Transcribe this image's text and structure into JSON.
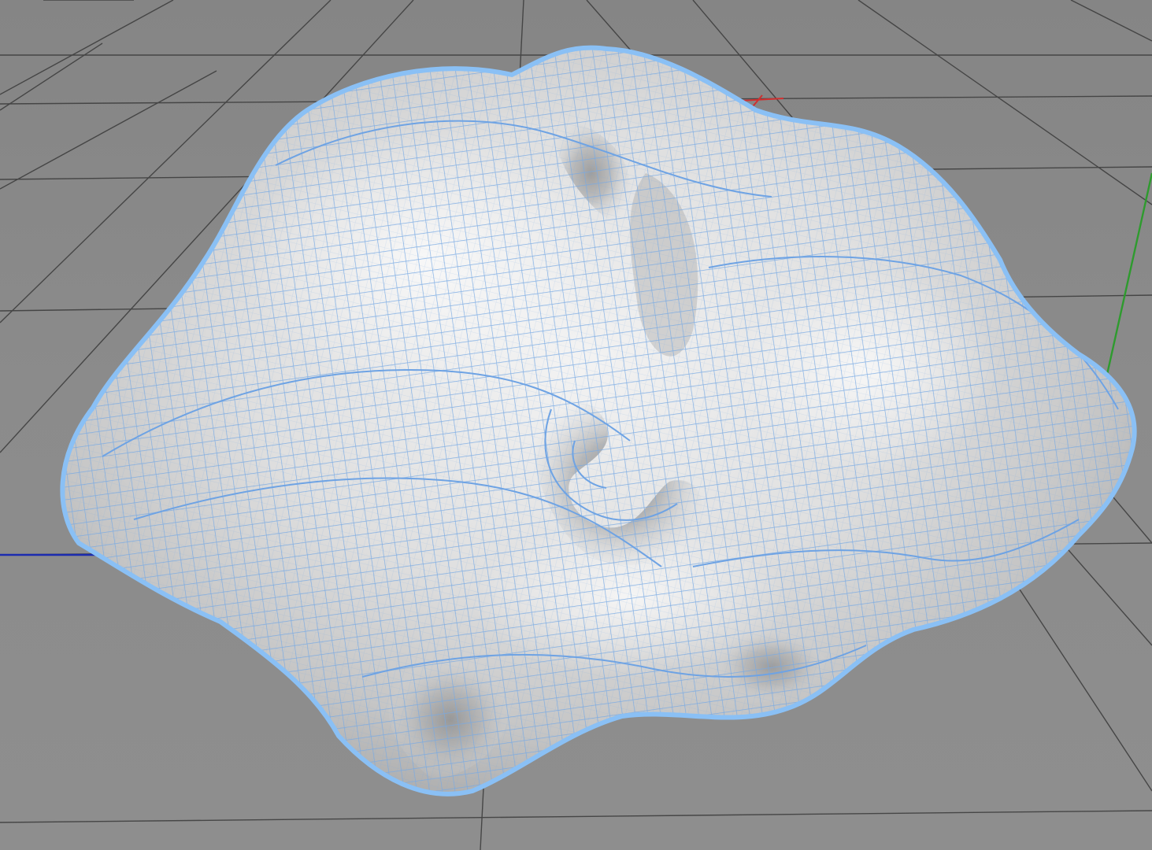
{
  "viewport": {
    "background": "#8b8b8b",
    "grid_color": "#3a3a3a"
  },
  "object": {
    "surface_color": "#d9d9d9",
    "wireframe_color": "#6fa6e6",
    "outline_color": "#86b8f0"
  },
  "axes": {
    "x_color": "#d03030",
    "y_color": "#2e9b2e",
    "z_color": "#1c2cb0"
  }
}
